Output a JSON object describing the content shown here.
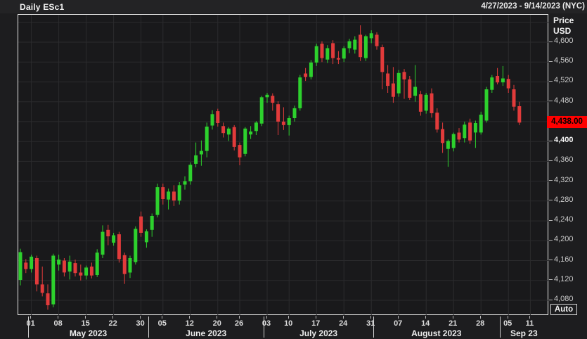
{
  "header": {
    "title": "Daily ESc1",
    "date_range": "4/27/2023 - 9/14/2023 (NYC)"
  },
  "axis": {
    "price_header_line1": "Price",
    "price_header_line2": "USD",
    "last_price_label": "4,438.00",
    "auto_label": "Auto",
    "y_labels": [
      {
        "label": "4,600",
        "value": 4600,
        "bold": false
      },
      {
        "label": "4,560",
        "value": 4560,
        "bold": false
      },
      {
        "label": "4,520",
        "value": 4520,
        "bold": false
      },
      {
        "label": "4,480",
        "value": 4480,
        "bold": false
      },
      {
        "label": "4,400",
        "value": 4400,
        "bold": true
      },
      {
        "label": "4,360",
        "value": 4360,
        "bold": false
      },
      {
        "label": "4,320",
        "value": 4320,
        "bold": false
      },
      {
        "label": "4,280",
        "value": 4280,
        "bold": false
      },
      {
        "label": "4,240",
        "value": 4240,
        "bold": false
      },
      {
        "label": "4,200",
        "value": 4200,
        "bold": false
      },
      {
        "label": "4,160",
        "value": 4160,
        "bold": false
      },
      {
        "label": "4,120",
        "value": 4120,
        "bold": false
      },
      {
        "label": "4,080",
        "value": 4080,
        "bold": false
      }
    ]
  },
  "colors": {
    "up": "#2dd12d",
    "down": "#e23b3b",
    "last_price_bg": "#ff0000",
    "gridline": "#2b2b2d",
    "plot_bg": "#19191b"
  },
  "chart_data": {
    "type": "candlestick",
    "symbol": "ESc1",
    "interval": "Daily",
    "title": "Daily ESc1",
    "currency": "USD",
    "last_price": 4438.0,
    "y_range": [
      4050,
      4655
    ],
    "gridline_prices": [
      4640,
      4600,
      4560,
      4520,
      4480,
      4440,
      4400,
      4360,
      4320,
      4280,
      4240,
      4200,
      4160,
      4120,
      4080
    ],
    "x_ticks": [
      [
        "01",
        2
      ],
      [
        "08",
        7
      ],
      [
        "15",
        12
      ],
      [
        "22",
        17
      ],
      [
        "30",
        22
      ],
      [
        "05",
        26
      ],
      [
        "12",
        31
      ],
      [
        "20",
        36
      ],
      [
        "26",
        40
      ],
      [
        "03",
        45
      ],
      [
        "10",
        49
      ],
      [
        "17",
        54
      ],
      [
        "24",
        59
      ],
      [
        "31",
        64
      ],
      [
        "07",
        69
      ],
      [
        "14",
        74
      ],
      [
        "21",
        79
      ],
      [
        "28",
        84
      ],
      [
        "05",
        89
      ],
      [
        "11",
        93
      ]
    ],
    "months": [
      [
        "May 2023",
        2
      ],
      [
        "June 2023",
        24
      ],
      [
        "July 2023",
        45
      ],
      [
        "August 2023",
        65
      ],
      [
        "Sep 23",
        88
      ]
    ],
    "candles": [
      [
        "Apr 27",
        4121,
        4184,
        4110,
        4177
      ],
      [
        "Apr 28",
        4156,
        4163,
        4135,
        4143
      ],
      [
        "May 01",
        4143,
        4172,
        4136,
        4168
      ],
      [
        "May 02",
        4165,
        4170,
        4098,
        4112
      ],
      [
        "May 03",
        4112,
        4148,
        4088,
        4095
      ],
      [
        "May 04",
        4094,
        4112,
        4061,
        4070
      ],
      [
        "May 05",
        4072,
        4174,
        4066,
        4170
      ],
      [
        "May 08",
        4152,
        4172,
        4140,
        4162
      ],
      [
        "May 09",
        4160,
        4165,
        4128,
        4136
      ],
      [
        "May 10",
        4138,
        4170,
        4122,
        4158
      ],
      [
        "May 11",
        4155,
        4162,
        4128,
        4135
      ],
      [
        "May 12",
        4136,
        4152,
        4120,
        4130
      ],
      [
        "May 15",
        4130,
        4150,
        4122,
        4146
      ],
      [
        "May 16",
        4148,
        4156,
        4124,
        4130
      ],
      [
        "May 17",
        4131,
        4183,
        4127,
        4176
      ],
      [
        "May 18",
        4172,
        4231,
        4165,
        4218
      ],
      [
        "May 19",
        4222,
        4232,
        4191,
        4209
      ],
      [
        "May 22",
        4196,
        4216,
        4190,
        4211
      ],
      [
        "May 23",
        4213,
        4218,
        4156,
        4163
      ],
      [
        "May 24",
        4171,
        4176,
        4113,
        4133
      ],
      [
        "May 25",
        4136,
        4170,
        4125,
        4165
      ],
      [
        "May 26",
        4157,
        4229,
        4152,
        4224
      ],
      [
        "May 30",
        4249,
        4259,
        4208,
        4216
      ],
      [
        "May 31",
        4197,
        4223,
        4186,
        4219
      ],
      [
        "Jun 01",
        4222,
        4255,
        4208,
        4250
      ],
      [
        "Jun 02",
        4252,
        4315,
        4247,
        4308
      ],
      [
        "Jun 05",
        4308,
        4315,
        4273,
        4284
      ],
      [
        "Jun 06",
        4283,
        4305,
        4263,
        4299
      ],
      [
        "Jun 07",
        4299,
        4312,
        4270,
        4281
      ],
      [
        "Jun 08",
        4281,
        4318,
        4273,
        4312
      ],
      [
        "Jun 09",
        4313,
        4330,
        4303,
        4320
      ],
      [
        "Jun 12",
        4320,
        4358,
        4313,
        4353
      ],
      [
        "Jun 13",
        4355,
        4398,
        4348,
        4372
      ],
      [
        "Jun 14",
        4374,
        4402,
        4351,
        4381
      ],
      [
        "Jun 15",
        4381,
        4438,
        4368,
        4430
      ],
      [
        "Jun 16",
        4432,
        4463,
        4424,
        4455
      ],
      [
        "Jun 20",
        4461,
        4466,
        4430,
        4437
      ],
      [
        "Jun 21",
        4431,
        4438,
        4408,
        4417
      ],
      [
        "Jun 22",
        4414,
        4429,
        4401,
        4426
      ],
      [
        "Jun 23",
        4429,
        4433,
        4382,
        4389
      ],
      [
        "Jun 26",
        4393,
        4398,
        4352,
        4368
      ],
      [
        "Jun 27",
        4375,
        4429,
        4370,
        4426
      ],
      [
        "Jun 28",
        4414,
        4431,
        4405,
        4420
      ],
      [
        "Jun 29",
        4421,
        4441,
        4413,
        4438
      ],
      [
        "Jun 30",
        4436,
        4492,
        4431,
        4489
      ],
      [
        "Jul 03",
        4489,
        4498,
        4478,
        4494
      ],
      [
        "Jul 05",
        4492,
        4497,
        4462,
        4478
      ],
      [
        "Jul 06",
        4475,
        4481,
        4413,
        4440
      ],
      [
        "Jul 07",
        4440,
        4469,
        4423,
        4433
      ],
      [
        "Jul 10",
        4433,
        4452,
        4412,
        4447
      ],
      [
        "Jul 11",
        4447,
        4472,
        4440,
        4467
      ],
      [
        "Jul 12",
        4467,
        4534,
        4462,
        4529
      ],
      [
        "Jul 13",
        4537,
        4548,
        4522,
        4530
      ],
      [
        "Jul 14",
        4530,
        4564,
        4525,
        4559
      ],
      [
        "Jul 17",
        4559,
        4597,
        4552,
        4592
      ],
      [
        "Jul 18",
        4597,
        4602,
        4560,
        4568
      ],
      [
        "Jul 19",
        4565,
        4594,
        4558,
        4588
      ],
      [
        "Jul 20",
        4598,
        4604,
        4556,
        4568
      ],
      [
        "Jul 21",
        4568,
        4582,
        4556,
        4565
      ],
      [
        "Jul 24",
        4567,
        4592,
        4560,
        4588
      ],
      [
        "Jul 25",
        4588,
        4607,
        4578,
        4602
      ],
      [
        "Jul 26",
        4585,
        4612,
        4577,
        4605
      ],
      [
        "Jul 27",
        4615,
        4634,
        4562,
        4570
      ],
      [
        "Jul 28",
        4568,
        4615,
        4562,
        4612
      ],
      [
        "Jul 31",
        4608,
        4624,
        4598,
        4618
      ],
      [
        "Aug 01",
        4615,
        4620,
        4585,
        4592
      ],
      [
        "Aug 02",
        4590,
        4595,
        4505,
        4540
      ],
      [
        "Aug 03",
        4537,
        4554,
        4498,
        4512
      ],
      [
        "Aug 04",
        4517,
        4550,
        4478,
        4490
      ],
      [
        "Aug 07",
        4497,
        4544,
        4490,
        4538
      ],
      [
        "Aug 08",
        4540,
        4546,
        4486,
        4525
      ],
      [
        "Aug 09",
        4525,
        4532,
        4484,
        4488
      ],
      [
        "Aug 10",
        4492,
        4554,
        4480,
        4510
      ],
      [
        "Aug 11",
        4495,
        4502,
        4452,
        4460
      ],
      [
        "Aug 14",
        4462,
        4498,
        4456,
        4494
      ],
      [
        "Aug 15",
        4497,
        4507,
        4448,
        4457
      ],
      [
        "Aug 16",
        4458,
        4467,
        4418,
        4424
      ],
      [
        "Aug 17",
        4425,
        4438,
        4377,
        4397
      ],
      [
        "Aug 18",
        4385,
        4404,
        4349,
        4401
      ],
      [
        "Aug 21",
        4387,
        4418,
        4380,
        4415
      ],
      [
        "Aug 22",
        4418,
        4427,
        4398,
        4404
      ],
      [
        "Aug 23",
        4407,
        4440,
        4398,
        4434
      ],
      [
        "Aug 24",
        4438,
        4446,
        4395,
        4402
      ],
      [
        "Aug 25",
        4418,
        4442,
        4387,
        4437
      ],
      [
        "Aug 28",
        4418,
        4460,
        4414,
        4454
      ],
      [
        "Aug 29",
        4442,
        4510,
        4438,
        4505
      ],
      [
        "Aug 30",
        4504,
        4534,
        4498,
        4529
      ],
      [
        "Aug 31",
        4532,
        4548,
        4515,
        4519
      ],
      [
        "Sep 01",
        4519,
        4552,
        4512,
        4527
      ],
      [
        "Sep 05",
        4526,
        4534,
        4498,
        4507
      ],
      [
        "Sep 06",
        4505,
        4514,
        4462,
        4470
      ],
      [
        "Sep 07",
        4471,
        4480,
        4433,
        4438
      ]
    ]
  }
}
